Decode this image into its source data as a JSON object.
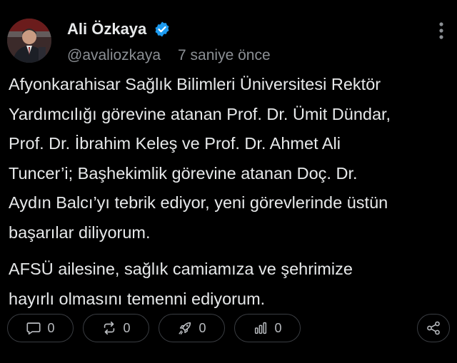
{
  "post": {
    "author": {
      "name": "Ali Özkaya",
      "handle": "@avaliozkaya",
      "verified": true,
      "avatar_icon": "profile-photo"
    },
    "timestamp": "7 saniye önce",
    "paragraphs": [
      "Afyonkarahisar Sağlık Bilimleri Üniversitesi Rektör\nYardımcılığı görevine atanan Prof. Dr. Ümit Dündar,\nProf. Dr. İbrahim Keleş ve Prof. Dr. Ahmet Ali\nTuncer’i; Başhekimlik görevine atanan Doç. Dr.\nAydın Balcı’yı tebrik ediyor, yeni görevlerinde üstün\nbaşarılar diliyorum.",
      "AFSÜ ailesine, sağlık camiamıza ve şehrimize\nhayırlı olmasını temenni ediyorum."
    ],
    "actions": {
      "reply": {
        "icon": "comment-icon",
        "count": "0"
      },
      "repost": {
        "icon": "repost-icon",
        "count": "0"
      },
      "boost": {
        "icon": "rocket-icon",
        "count": "0"
      },
      "views": {
        "icon": "bar-chart-icon",
        "count": "0"
      },
      "share": {
        "icon": "share-icon"
      }
    }
  },
  "colors": {
    "background": "#000000",
    "text": "#e7e9ea",
    "muted": "#8b8f94",
    "verified_badge": "#1d9bf0",
    "pill_border": "#3a3d42"
  }
}
